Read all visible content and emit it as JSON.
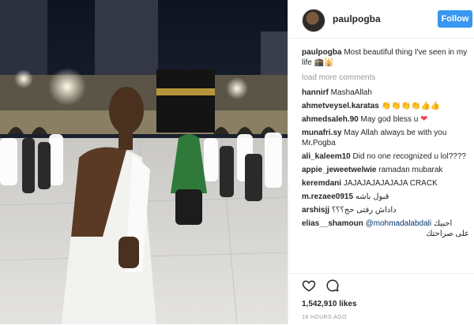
{
  "post": {
    "username": "paulpogba",
    "follow_label": "Follow",
    "likes": "1,542,910 likes",
    "time": "18 HOURS AGO"
  },
  "caption": {
    "user": "paulpogba",
    "text": "Most beautiful thing I've seen in my life"
  },
  "load_more": "load more comments",
  "comments": [
    {
      "user": "hannirf",
      "text": "MashaAllah"
    },
    {
      "user": "ahmetveysel.karatas",
      "text": ""
    },
    {
      "user": "ahmedsaleh.90",
      "text": "May god bless u"
    },
    {
      "user": "munafri.sy",
      "text": "May Allah always be with you Mr.Pogba"
    },
    {
      "user": "ali_kaleem10",
      "text": "Did no one recognized u lol????"
    },
    {
      "user": "appie_jeweetwelwie",
      "text": "ramadan mubarak"
    },
    {
      "user": "keremdani",
      "text": "JAJAJAJAJAJAJA CRACK"
    },
    {
      "user": "m.rezaee0915",
      "text": "قبول باشه"
    },
    {
      "user": "arshisjj",
      "text": "داداش رفتی حج؟؟؟"
    },
    {
      "user": "elias__shamoun",
      "mention": "@mohmadalabdali",
      "text": "احبيك",
      "text2": "على صراحتك"
    }
  ],
  "icons": {
    "heart": "heart-icon",
    "comment": "comment-icon",
    "avatar": "avatar"
  },
  "colors": {
    "follow_button": "#3897f0",
    "heart_emoji": "#ed4956",
    "muted": "#999999"
  }
}
